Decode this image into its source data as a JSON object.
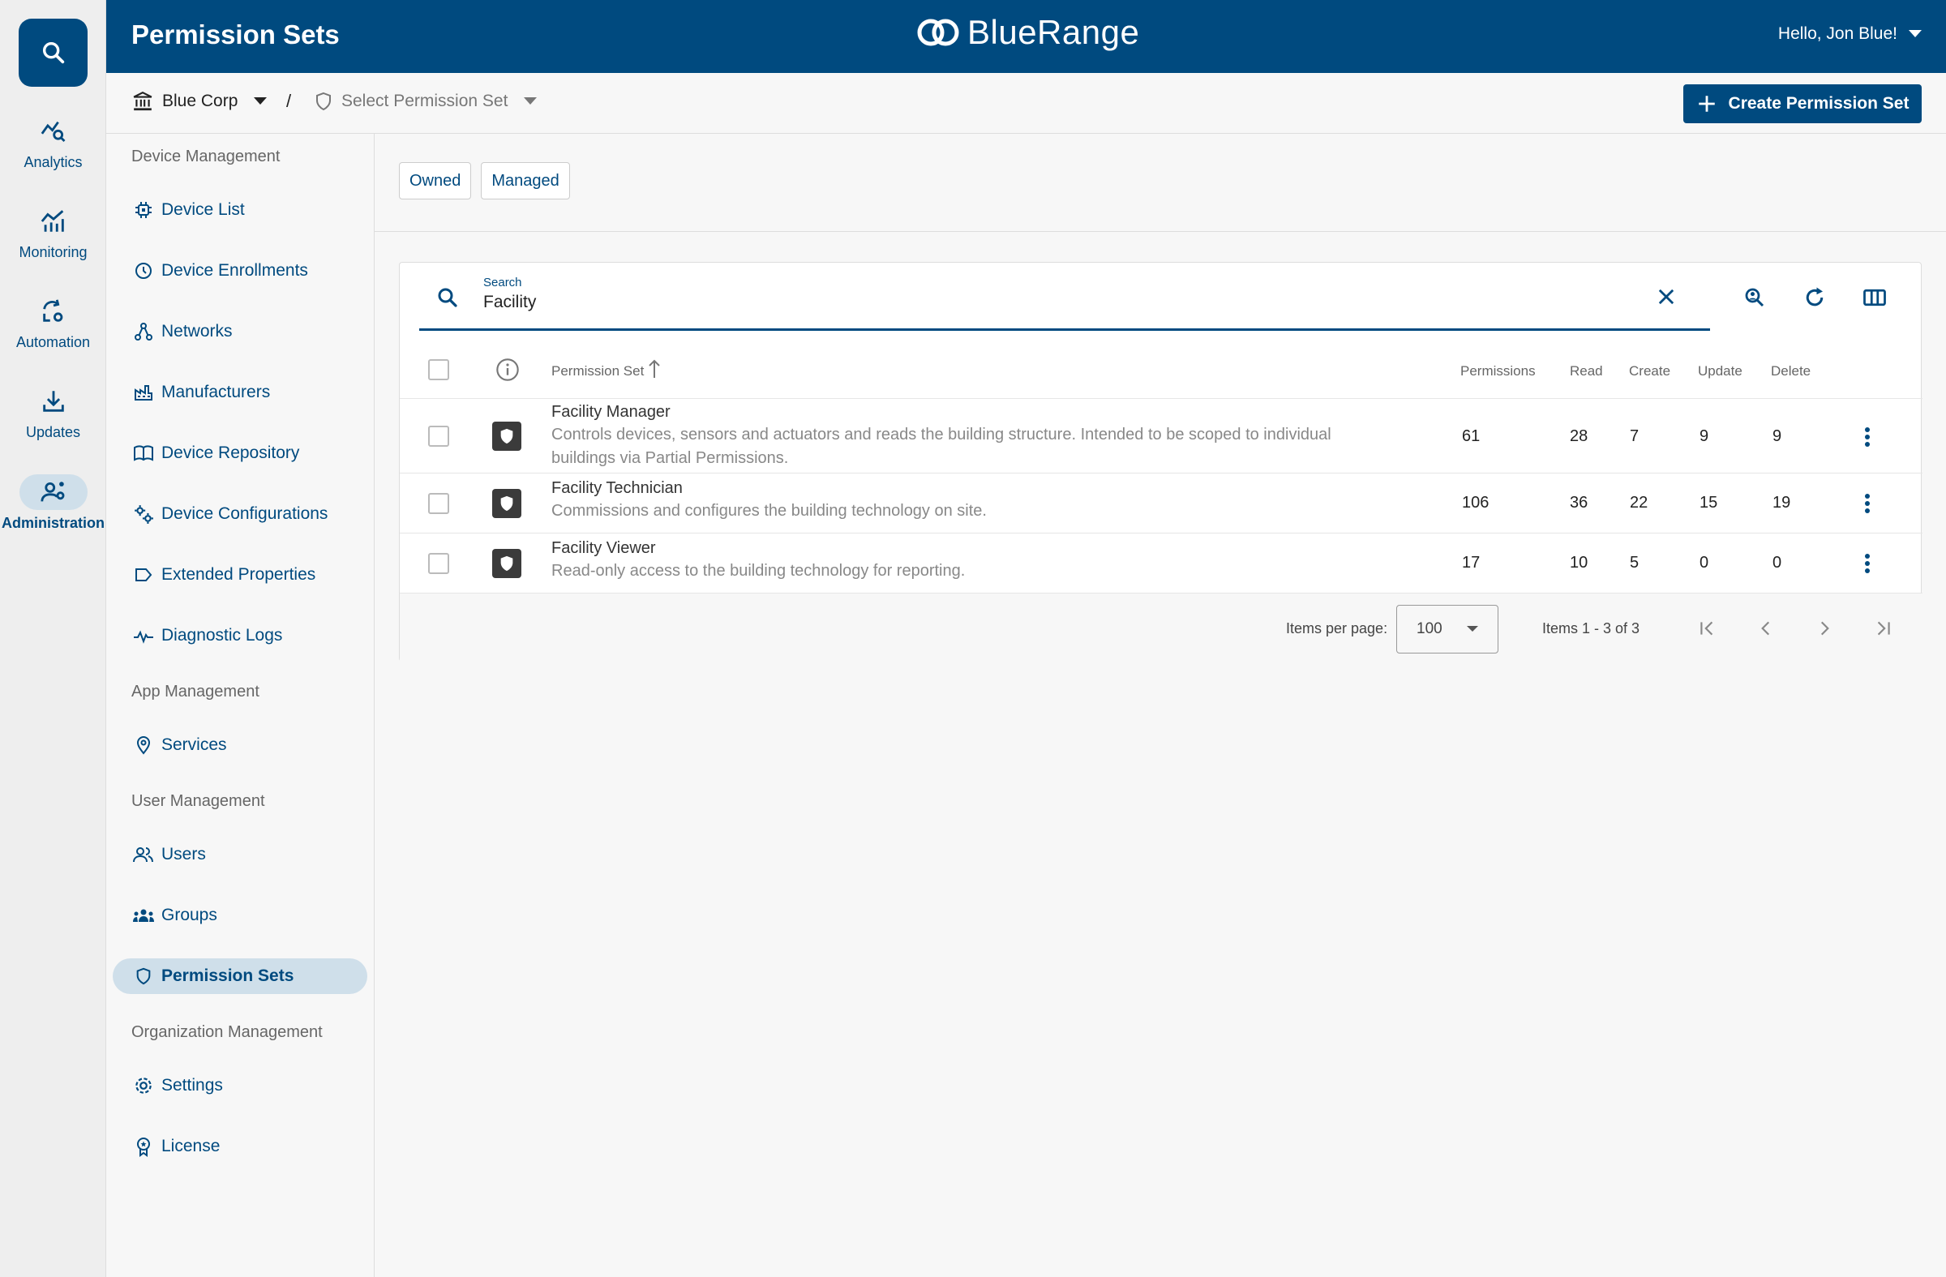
{
  "header": {
    "title": "Permission Sets",
    "brand": "BlueRange",
    "user_greeting": "Hello, Jon Blue!"
  },
  "rail": {
    "items": [
      {
        "label": "Analytics",
        "icon": "analytics-icon"
      },
      {
        "label": "Monitoring",
        "icon": "monitoring-icon"
      },
      {
        "label": "Automation",
        "icon": "automation-icon"
      },
      {
        "label": "Updates",
        "icon": "updates-icon"
      },
      {
        "label": "Administration",
        "icon": "administration-icon",
        "active": true
      }
    ]
  },
  "breadcrumb": {
    "organization": "Blue Corp",
    "separator": "/",
    "permission_set": "Select Permission Set"
  },
  "actions": {
    "create_label": "Create Permission Set"
  },
  "nav": {
    "sections": [
      {
        "title": "Device Management",
        "items": [
          {
            "label": "Device List",
            "icon": "chip-icon"
          },
          {
            "label": "Device Enrollments",
            "icon": "clock-icon"
          },
          {
            "label": "Networks",
            "icon": "network-icon"
          },
          {
            "label": "Manufacturers",
            "icon": "factory-icon"
          },
          {
            "label": "Device Repository",
            "icon": "book-icon"
          },
          {
            "label": "Device Configurations",
            "icon": "gears-icon"
          },
          {
            "label": "Extended Properties",
            "icon": "tag-icon"
          },
          {
            "label": "Diagnostic Logs",
            "icon": "pulse-icon"
          }
        ]
      },
      {
        "title": "App Management",
        "items": [
          {
            "label": "Services",
            "icon": "location-pin-icon"
          }
        ]
      },
      {
        "title": "User Management",
        "items": [
          {
            "label": "Users",
            "icon": "users-icon"
          },
          {
            "label": "Groups",
            "icon": "groups-icon"
          },
          {
            "label": "Permission Sets",
            "icon": "shield-icon",
            "active": true
          }
        ]
      },
      {
        "title": "Organization Management",
        "items": [
          {
            "label": "Settings",
            "icon": "gear-icon"
          },
          {
            "label": "License",
            "icon": "license-badge-icon"
          }
        ]
      }
    ]
  },
  "tabs": [
    "Owned",
    "Managed"
  ],
  "search": {
    "label": "Search",
    "value": "Facility"
  },
  "table": {
    "columns": {
      "name": "Permission Set",
      "permissions": "Permissions",
      "read": "Read",
      "create": "Create",
      "update": "Update",
      "delete": "Delete"
    },
    "rows": [
      {
        "name": "Facility Manager",
        "description": "Controls devices, sensors and actuators and reads the building structure. Intended to be scoped to individual buildings via Partial Permissions.",
        "permissions": "61",
        "read": "28",
        "create": "7",
        "update": "9",
        "delete": "9"
      },
      {
        "name": "Facility Technician",
        "description": "Commissions and configures the building technology on site.",
        "permissions": "106",
        "read": "36",
        "create": "22",
        "update": "15",
        "delete": "19"
      },
      {
        "name": "Facility Viewer",
        "description": "Read-only access to the building technology for reporting.",
        "permissions": "17",
        "read": "10",
        "create": "5",
        "update": "0",
        "delete": "0"
      }
    ]
  },
  "pagination": {
    "items_per_page_label": "Items per page:",
    "items_per_page": "100",
    "range": "Items 1 - 3 of 3"
  },
  "colors": {
    "primary": "#004a7f",
    "active_bg": "#cfdfea"
  }
}
